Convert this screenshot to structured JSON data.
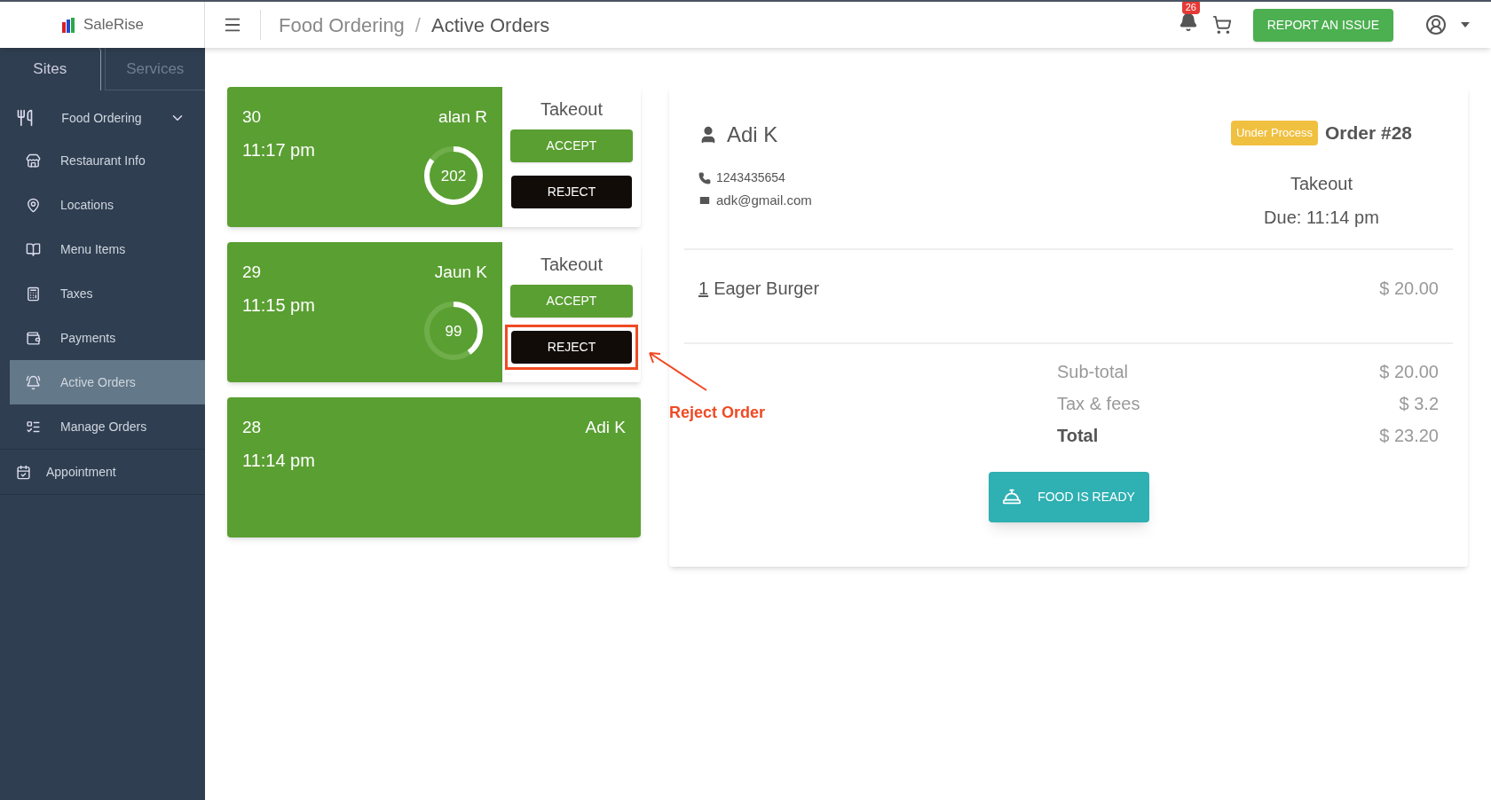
{
  "header": {
    "logo": "SaleRise",
    "breadcrumb": [
      "Food Ordering",
      "Active Orders"
    ],
    "breadcrumb_separator": "/",
    "notification_count": "26",
    "report_button": "REPORT AN ISSUE"
  },
  "sidebar": {
    "tabs": [
      {
        "label": "Sites",
        "selected": true
      },
      {
        "label": "Services",
        "selected": false
      }
    ],
    "items": [
      {
        "label": "Food Ordering",
        "expanded": true,
        "children": [
          {
            "label": "Restaurant Info",
            "selected": false
          },
          {
            "label": "Locations",
            "selected": false
          },
          {
            "label": "Menu Items",
            "selected": false
          },
          {
            "label": "Taxes",
            "selected": false
          },
          {
            "label": "Payments",
            "selected": false
          },
          {
            "label": "Active Orders",
            "selected": true
          },
          {
            "label": "Manage Orders",
            "selected": false
          }
        ]
      },
      {
        "label": "Appointment",
        "selected": false
      }
    ]
  },
  "orders": [
    {
      "number": "30",
      "customer": "alan R",
      "time": "11:17 pm",
      "timer": "202",
      "level": 0.85,
      "type": "Takeout",
      "accept": "ACCEPT",
      "reject": "REJECT",
      "highlighted": false
    },
    {
      "number": "29",
      "customer": "Jaun K",
      "time": "11:15 pm",
      "timer": "99",
      "level": 0.4,
      "type": "Takeout",
      "accept": "ACCEPT",
      "reject": "REJECT",
      "highlighted": true
    },
    {
      "number": "28",
      "customer": "Adi K",
      "time": "11:14 pm"
    }
  ],
  "annotation": {
    "text": "Reject Order"
  },
  "detail": {
    "customer": "Adi K",
    "status": "Under Process",
    "order": "Order #28",
    "phone": "1243435654",
    "email": "adk@gmail.com",
    "type": "Takeout",
    "due": "Due: 11:14 pm",
    "items": [
      {
        "qty": "1",
        "name": "Eager Burger",
        "price": "$ 20.00"
      }
    ],
    "totals": [
      {
        "label": "Sub-total",
        "value": "$ 20.00",
        "bold": false
      },
      {
        "label": "Tax & fees",
        "value": "$ 3.2",
        "bold": false
      },
      {
        "label": "Total",
        "value": "$ 23.20",
        "bold": true
      }
    ],
    "action": "FOOD IS READY"
  }
}
